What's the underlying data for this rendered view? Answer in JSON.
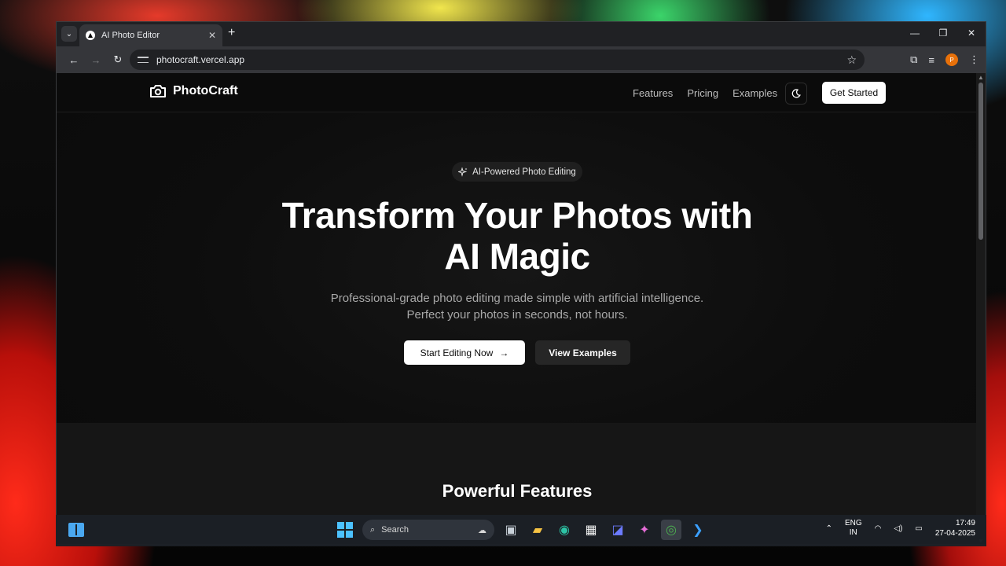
{
  "browser": {
    "tab_title": "AI Photo Editor",
    "url": "photocraft.vercel.app",
    "avatar_letter": "P"
  },
  "site": {
    "brand": "PhotoCraft",
    "nav": [
      "Features",
      "Pricing",
      "Examples"
    ],
    "get_started": "Get Started"
  },
  "hero": {
    "badge": "AI-Powered Photo Editing",
    "headline_line1": "Transform Your Photos with",
    "headline_line2": "AI Magic",
    "sub_line1": "Professional-grade photo editing made simple with artificial intelligence.",
    "sub_line2": "Perfect your photos in seconds, not hours.",
    "primary_cta": "Start Editing Now",
    "secondary_cta": "View Examples"
  },
  "features": {
    "title": "Powerful Features"
  },
  "taskbar": {
    "search_placeholder": "Search",
    "lang_line1": "ENG",
    "lang_line2": "IN",
    "time": "17:49",
    "date": "27-04-2025"
  },
  "colors": {
    "page_bg": "#0b0b0b",
    "accent_white": "#ffffff",
    "chrome_dark": "#202124",
    "avatar": "#e8710a"
  }
}
